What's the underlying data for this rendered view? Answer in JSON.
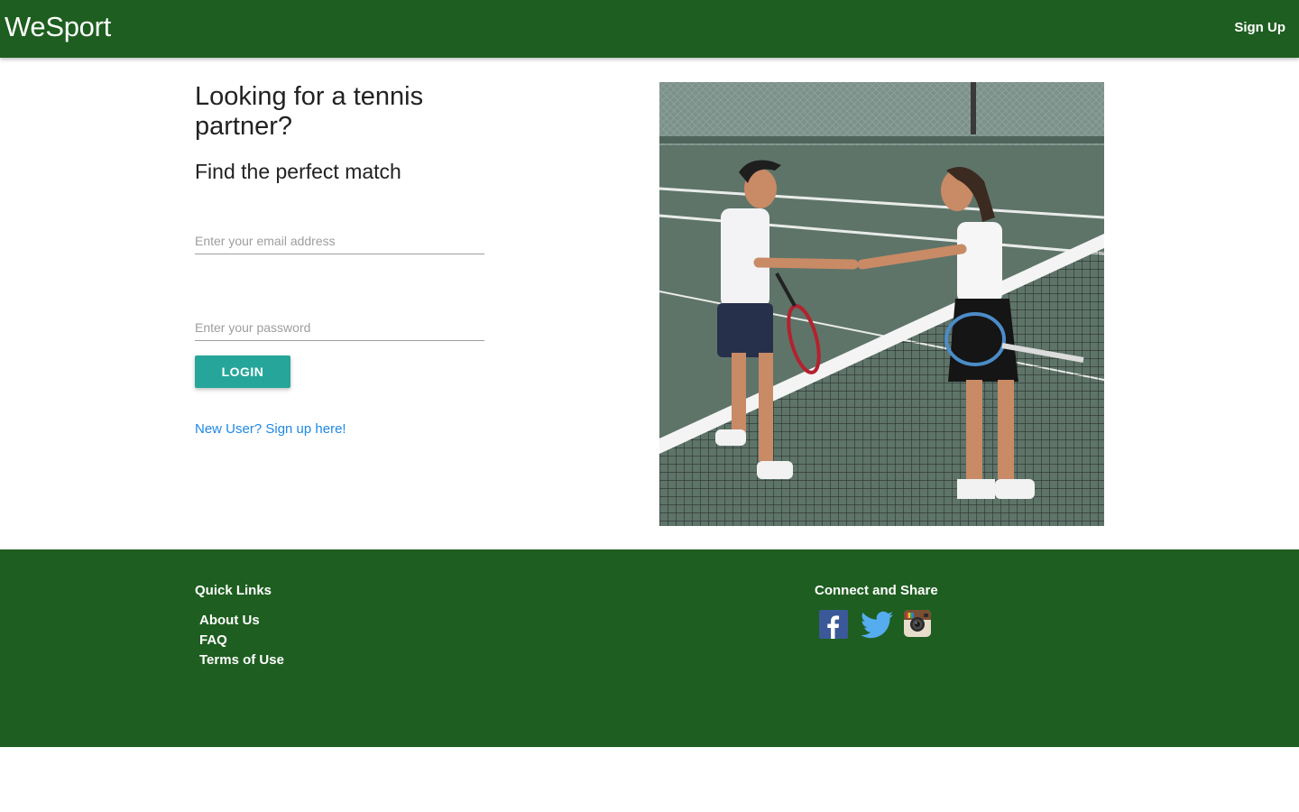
{
  "navbar": {
    "brand": "WeSport",
    "signup_label": "Sign Up",
    "background_color": "#1e5e20"
  },
  "hero": {
    "title": "Looking for a tennis partner?",
    "subtitle": "Find the perfect match"
  },
  "login_form": {
    "email_placeholder": "Enter your email address",
    "email_value": "",
    "password_placeholder": "Enter your password",
    "password_value": "",
    "login_label": "LOGIN",
    "login_color": "#26a69a",
    "signup_link": "New User? Sign up here!",
    "link_color": "#1e88e5"
  },
  "image": {
    "subject": "tennis-players-handshake-photo"
  },
  "footer": {
    "quick_links_heading": "Quick Links",
    "links": [
      {
        "label": "About Us"
      },
      {
        "label": "FAQ"
      },
      {
        "label": "Terms of Use"
      }
    ],
    "connect_heading": "Connect and Share",
    "social": [
      {
        "icon": "facebook-icon",
        "color": "#3b5998"
      },
      {
        "icon": "twitter-icon",
        "color": "#55acee"
      },
      {
        "icon": "instagram-icon",
        "color": "#9b6a4a"
      }
    ]
  }
}
